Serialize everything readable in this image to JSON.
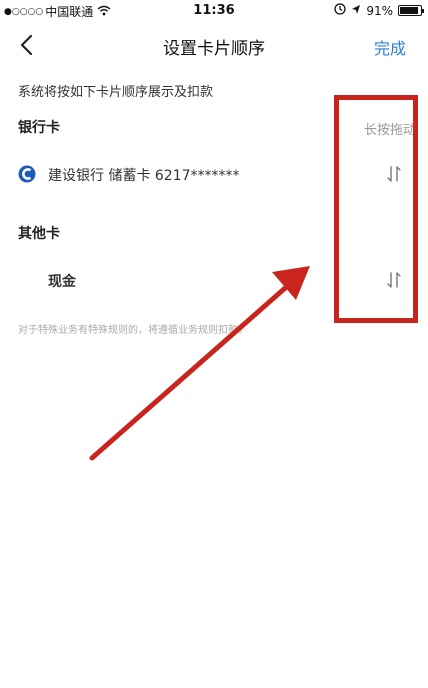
{
  "status_bar": {
    "signal_dots": "●○○○○",
    "carrier": "中国联通",
    "time": "11:36",
    "battery_percent": "91%",
    "battery_level": 0.91
  },
  "nav": {
    "title": "设置卡片顺序",
    "done_label": "完成"
  },
  "description": "系统将按如下卡片顺序展示及扣款",
  "bank_section": {
    "title": "银行卡",
    "hint": "长按拖动",
    "cards": [
      {
        "label": "建设银行 储蓄卡 6217*******"
      }
    ]
  },
  "other_section": {
    "title": "其他卡",
    "cards": [
      {
        "label": "现金"
      }
    ]
  },
  "footer_note": "对于特殊业务有特殊规则的，将遵循业务规则扣款。",
  "colors": {
    "accent": "#2e7fd8",
    "bank_logo": "#1b5cb8",
    "annotation": "#c9251d"
  },
  "icons": {
    "back": "chevron-left-icon",
    "bank_logo": "ccb-logo-icon",
    "drag": "reorder-arrows-icon"
  }
}
